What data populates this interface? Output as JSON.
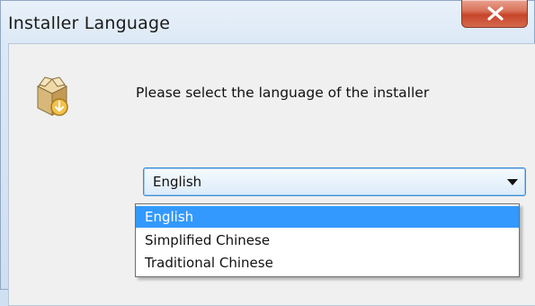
{
  "window": {
    "title": "Installer Language",
    "close_icon": "close-icon"
  },
  "dialog": {
    "icon": "installer-box-icon",
    "prompt": "Please select the language of the installer"
  },
  "language_select": {
    "selected": "English",
    "options": [
      "English",
      "Simplified Chinese",
      "Traditional Chinese"
    ],
    "highlighted_index": 0
  },
  "colors": {
    "highlight": "#3399ff",
    "close_button": "#c7452a",
    "focus_border": "#3f8fd0"
  }
}
